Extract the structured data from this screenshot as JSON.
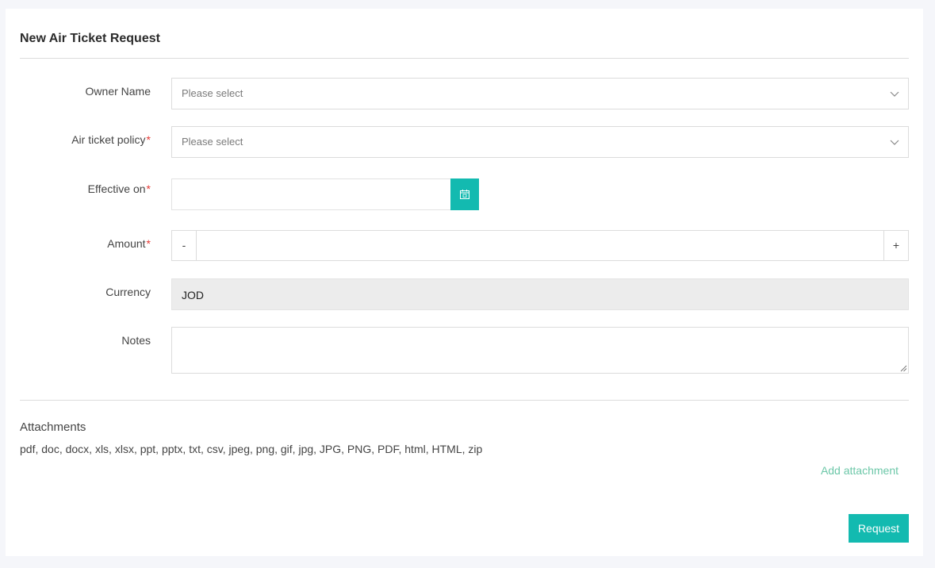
{
  "form": {
    "title": "New Air Ticket Request",
    "required_marker": "*",
    "owner_name": {
      "label": "Owner Name",
      "placeholder": "Please select"
    },
    "air_ticket_policy": {
      "label": "Air ticket policy",
      "placeholder": "Please select"
    },
    "effective_on": {
      "label": "Effective on",
      "value": ""
    },
    "amount": {
      "label": "Amount",
      "value": "",
      "minus_label": "-",
      "plus_label": "+"
    },
    "currency": {
      "label": "Currency",
      "value": "JOD"
    },
    "notes": {
      "label": "Notes",
      "value": ""
    }
  },
  "attachments": {
    "title": "Attachments",
    "allowed_types": "pdf, doc, docx, xls, xlsx, ppt, pptx, txt, csv, jpeg, png, gif, jpg, JPG, PNG, PDF, html, HTML, zip",
    "add_label": "Add attachment"
  },
  "actions": {
    "request_label": "Request"
  },
  "icons": {
    "dropdown": "chevron-down-icon",
    "calendar": "calendar-icon",
    "resize": "resize-grip-icon"
  },
  "colors": {
    "accent": "#13bab0",
    "link": "#6cc7a8",
    "required": "#e53935",
    "readonly_bg": "#ececec"
  }
}
